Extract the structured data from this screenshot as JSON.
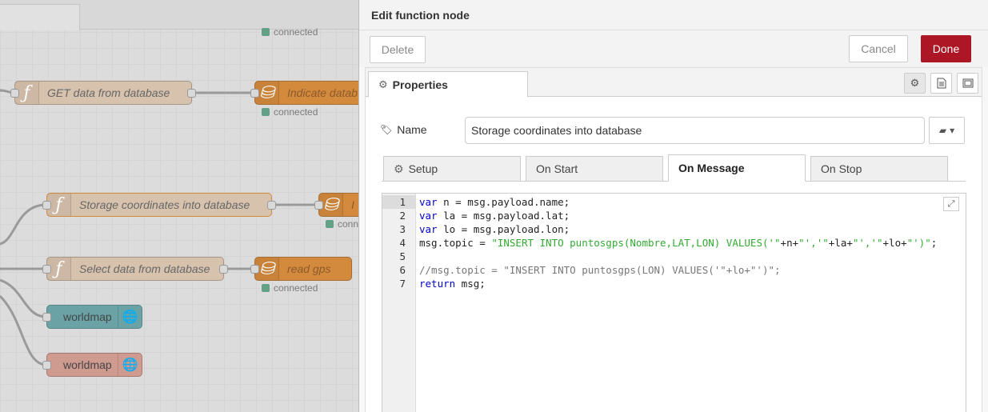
{
  "workspace": {
    "status_text": "connected",
    "nodes": {
      "get_data": "GET data from database",
      "indicate_db": "Indicate datab",
      "storage_coords": "Storage coordinates into database",
      "storage_out": "I",
      "select_data": "Select data from database",
      "read_gps": "read gps",
      "worldmap_1": "worldmap",
      "worldmap_2": "worldmap",
      "conn_partial": "conn"
    }
  },
  "tray": {
    "title": "Edit function node",
    "delete_label": "Delete",
    "cancel_label": "Cancel",
    "done_label": "Done",
    "properties_tab": "Properties",
    "name_label": "Name",
    "name_value": "Storage coordinates into database",
    "subtabs": [
      "Setup",
      "On Start",
      "On Message",
      "On Stop"
    ],
    "active_subtab": "On Message",
    "colors": {
      "done": "#ad1625"
    }
  },
  "editor": {
    "line_numbers": [
      "1",
      "2",
      "3",
      "4",
      "5",
      "6",
      "7"
    ],
    "lines": [
      "var n = msg.payload.name;",
      "var la = msg.payload.lat;",
      "var lo = msg.payload.lon;",
      "msg.topic = \"INSERT INTO puntosgps(Nombre,LAT,LON) VALUES('\"+n+\"','\"+la+\"','\"+lo+\"')\";",
      "",
      "//msg.topic = \"INSERT INTO puntosgps(LON) VALUES('\"+lo+\"')\";",
      "return msg;"
    ]
  }
}
